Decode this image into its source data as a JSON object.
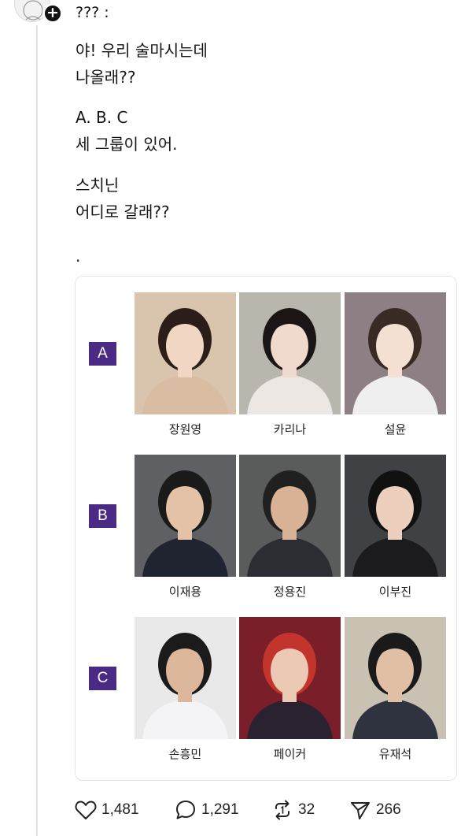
{
  "post": {
    "author": "??? :",
    "lines": [
      "야! 우리 술마시는데\n나올래??",
      "A. B. C\n세 그룹이 있어.",
      "스치닌\n어디로 갈래??",
      "."
    ]
  },
  "groups": [
    {
      "label": "A",
      "people": [
        {
          "name": "장원영",
          "bg": "#d9c4ad",
          "hair": "#2b1d17",
          "skin": "#f1d6c4",
          "cloth": "#d8bda3"
        },
        {
          "name": "카리나",
          "bg": "#b9b6ae",
          "hair": "#1c1515",
          "skin": "#f0d9cd",
          "cloth": "#ece7e2"
        },
        {
          "name": "설윤",
          "bg": "#8d7f83",
          "hair": "#3a2a24",
          "skin": "#f4dfd3",
          "cloth": "#efefef"
        }
      ]
    },
    {
      "label": "B",
      "people": [
        {
          "name": "이재용",
          "bg": "#5e6063",
          "hair": "#1a1a1a",
          "skin": "#e4c2a8",
          "cloth": "#1f2430"
        },
        {
          "name": "정용진",
          "bg": "#5a5c5c",
          "hair": "#202020",
          "skin": "#d9b195",
          "cloth": "#2b2d33"
        },
        {
          "name": "이부진",
          "bg": "#3f4144",
          "hair": "#111111",
          "skin": "#ecd0bd",
          "cloth": "#1b1b1e"
        }
      ]
    },
    {
      "label": "C",
      "people": [
        {
          "name": "손흥민",
          "bg": "#e9e9ea",
          "hair": "#1b1b1b",
          "skin": "#dcb79c",
          "cloth": "#f4f4f6"
        },
        {
          "name": "페이커",
          "bg": "#7a1f2a",
          "hair": "#c2352c",
          "skin": "#ecc9b2",
          "cloth": "#2a2230"
        },
        {
          "name": "유재석",
          "bg": "#c9c2b2",
          "hair": "#1a1a1a",
          "skin": "#e0bfa4",
          "cloth": "#2f3340"
        }
      ]
    }
  ],
  "actions": {
    "likes": "1,481",
    "comments": "1,291",
    "reposts": "32",
    "shares": "266"
  },
  "icons": {
    "like": "heart-icon",
    "comment": "comment-bubble-icon",
    "repost": "repost-icon",
    "share": "send-icon",
    "follow": "plus-icon"
  },
  "colors": {
    "badge": "#4b2a86",
    "text": "#151515"
  }
}
